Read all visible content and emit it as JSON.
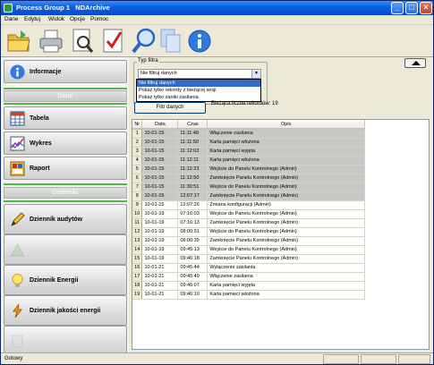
{
  "window": {
    "title": "Process Group 1   NDArchive"
  },
  "menu": [
    "Dane",
    "Edytuj",
    "Widok",
    "Opcje",
    "Pomoc"
  ],
  "toolbar": {
    "tools": [
      "open-folder-icon",
      "printer-icon",
      "print-preview-icon",
      "checkmark-icon",
      "magnifier-icon",
      "copy-pages-icon",
      "info-icon"
    ]
  },
  "sidebar": {
    "informacje": "Informacje",
    "section_dane": "Dane",
    "tabela": "Tabela",
    "wykres": "Wykres",
    "raport": "Raport",
    "section_dzienniki": "Dzienniki",
    "dziennik_audytow": "Dziennik audytów",
    "dziennik_energii": "Dziennik Energii",
    "dziennik_jakosci": "Dziennik jakości energii"
  },
  "filter": {
    "legend": "Typ filtra",
    "selected": "Nie filtruj danych",
    "options": [
      "Nie filtruj danych",
      "Pokaż tylko rekordy z bieżącej sesji",
      "Pokaż tylko zaniki zasilania"
    ],
    "button": "Filtr danych",
    "count_label": "Bieżąca liczba rekordów: 19"
  },
  "table": {
    "headers": [
      "Nr",
      "Data",
      "Czas",
      "Opis"
    ],
    "rows": [
      [
        "1",
        "10-01-15",
        "11:11:49",
        "Włączenie zasilania"
      ],
      [
        "2",
        "10-01-15",
        "11:11:50",
        "Karta pamięci włożona"
      ],
      [
        "3",
        "10-01-15",
        "11:12:03",
        "Karta pamięci wyjęta"
      ],
      [
        "4",
        "10-01-15",
        "11:12:11",
        "Karta pamięci włożona"
      ],
      [
        "5",
        "10-01-15",
        "11:12:23",
        "Wejście do Panelu Kontrolnego (Admin)"
      ],
      [
        "6",
        "10-01-15",
        "11:12:50",
        "Zamknięcie Panelu Kontrolnego (Admin)"
      ],
      [
        "7",
        "10-01-15",
        "11:30:51",
        "Wejście do Panelu Kontrolnego (Admin)"
      ],
      [
        "8",
        "10-01-15",
        "12:07:17",
        "Zamknięcie Panelu Kontrolnego (Admin)"
      ],
      [
        "9",
        "10-01-15",
        "12:07:26",
        "Zmiana konfiguracji (Admin)"
      ],
      [
        "10",
        "10-01-19",
        "07:16:03",
        "Wejście do Panelu Kontrolnego (Admin)"
      ],
      [
        "11",
        "10-01-19",
        "07:16:13",
        "Zamknięcie Panelu Kontrolnego (Admin)"
      ],
      [
        "12",
        "10-01-19",
        "08:00:31",
        "Wejście do Panelu Kontrolnego (Admin)"
      ],
      [
        "13",
        "10-01-19",
        "08:00:35",
        "Zamknięcie Panelu Kontrolnego (Admin)"
      ],
      [
        "14",
        "10-01-19",
        "09:45:13",
        "Wejście do Panelu Kontrolnego (Admin)"
      ],
      [
        "15",
        "10-01-19",
        "09:46:18",
        "Zamknięcie Panelu Kontrolnego (Admin)"
      ],
      [
        "16",
        "10-01-21",
        "09:45:44",
        "Wyłączenie zasilania"
      ],
      [
        "17",
        "10-01-21",
        "09:45:49",
        "Włączenie zasilania"
      ],
      [
        "18",
        "10-01-21",
        "09:46:07",
        "Karta pamięci wyjęta"
      ],
      [
        "19",
        "10-01-21",
        "09:46:10",
        "Karta pamięci włożona"
      ]
    ],
    "grey_rows": [
      1,
      2,
      3,
      4,
      5,
      6,
      7,
      8
    ]
  },
  "status": {
    "text": "Gotowy"
  }
}
